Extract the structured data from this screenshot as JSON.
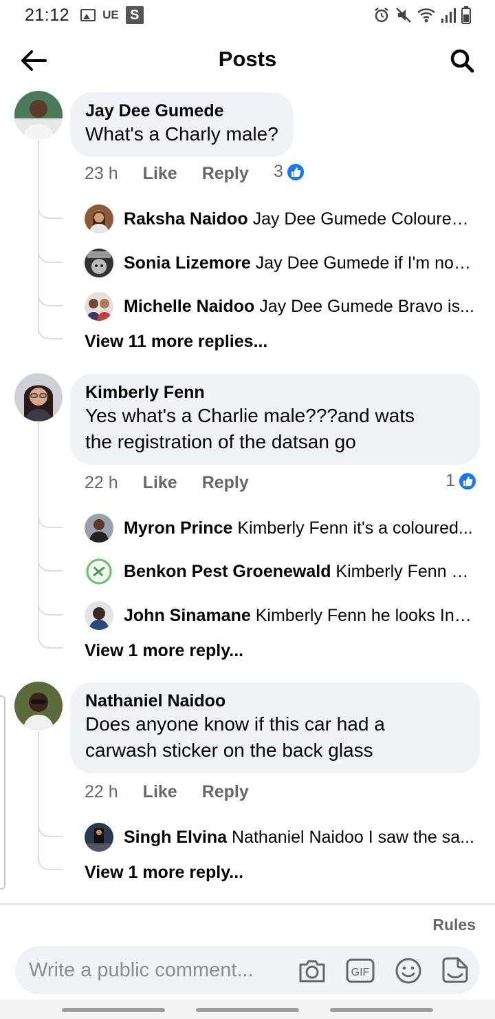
{
  "status": {
    "time": "21:12",
    "carrier": "UE",
    "app_badge": "S"
  },
  "header": {
    "title": "Posts"
  },
  "comments": [
    {
      "author": "Jay Dee Gumede",
      "text_lines": [
        "What's a Charly male?"
      ],
      "time": "23 h",
      "like": "Like",
      "reply": "Reply",
      "reactions": "3",
      "replies": [
        {
          "author": "Raksha Naidoo",
          "text": "Jay Dee Gumede Coloured..."
        },
        {
          "author": "Sonia Lizemore",
          "text": "Jay Dee Gumede if I'm not ..."
        },
        {
          "author": "Michelle Naidoo",
          "text": "Jay Dee Gumede Bravo is..."
        }
      ],
      "view_more": "View 11 more replies..."
    },
    {
      "author": "Kimberly Fenn",
      "text_lines": [
        "Yes what's a Charlie male???and wats",
        "the registration of the datsan go"
      ],
      "time": "22 h",
      "like": "Like",
      "reply": "Reply",
      "reactions": "1",
      "replies": [
        {
          "author": "Myron Prince",
          "text": "Kimberly Fenn it's a coloured..."
        },
        {
          "author": "Benkon Pest Groenewald",
          "text": "Kimberly Fenn a ..."
        },
        {
          "author": "John Sinamane",
          "text": "Kimberly Fenn he looks Indi..."
        }
      ],
      "view_more": "View 1 more reply..."
    },
    {
      "author": "Nathaniel Naidoo",
      "text_lines": [
        "Does anyone know if this car had a",
        "carwash sticker on the back glass"
      ],
      "time": "22 h",
      "like": "Like",
      "reply": "Reply",
      "replies": [
        {
          "author": "Singh Elvina",
          "text": "Nathaniel Naidoo I saw the sa..."
        }
      ],
      "view_more": "View 1 more reply..."
    }
  ],
  "footer": {
    "rules": "Rules",
    "comment_placeholder": "Write a public comment...",
    "icons": [
      "camera-icon",
      "gif-icon",
      "emoji-icon",
      "sticker-icon"
    ]
  },
  "colors": {
    "accent": "#1877f2",
    "bubble": "#f0f2f5",
    "muted": "#65676b"
  }
}
